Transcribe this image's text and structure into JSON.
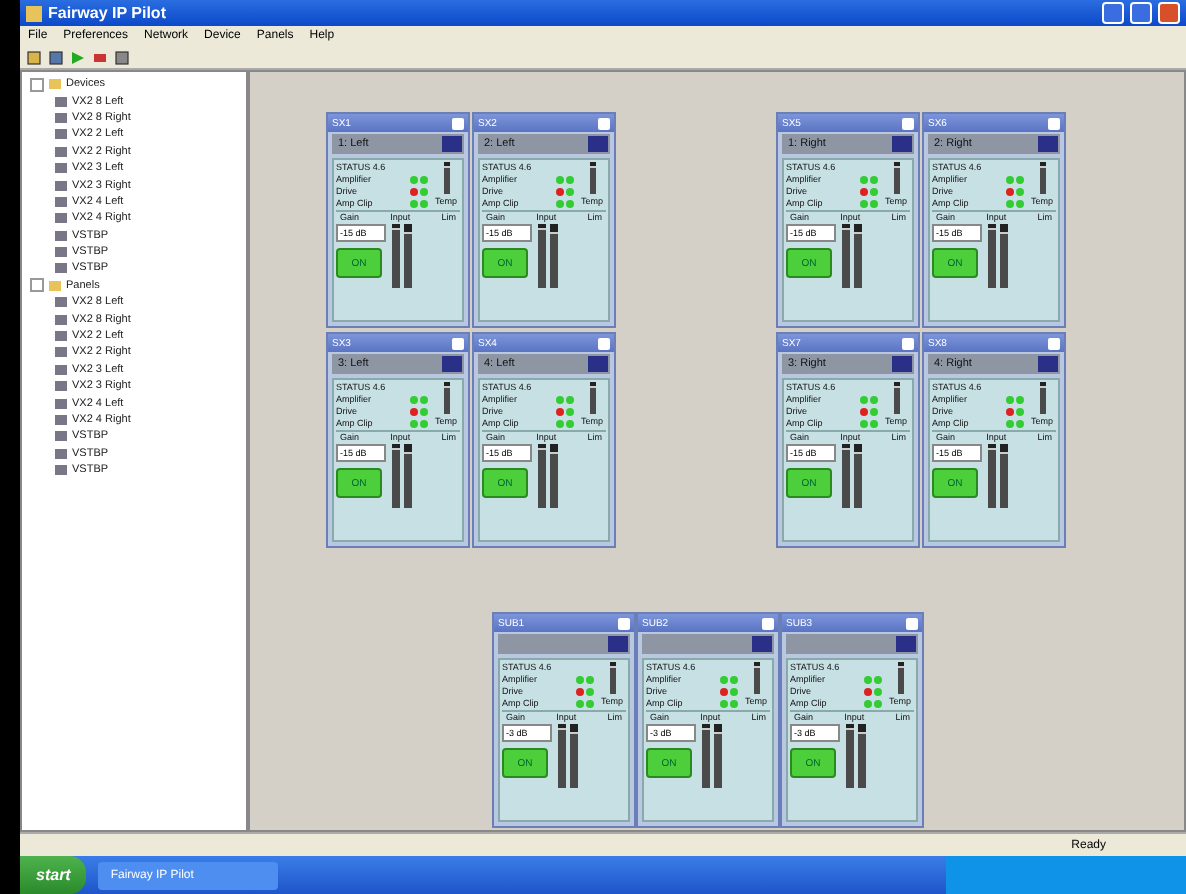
{
  "window": {
    "title": "Fairway IP Pilot"
  },
  "menu": [
    "File",
    "Preferences",
    "Network",
    "Device",
    "Panels",
    "Help"
  ],
  "tree": [
    {
      "label": "Devices",
      "expanded": true,
      "children": [
        {
          "label": "VX2 8 Left"
        },
        {
          "label": "VX2 8 Right"
        },
        {
          "label": "VX2 2 Left"
        },
        {
          "label": "VX2 2 Right"
        },
        {
          "label": "VX2 3 Left"
        },
        {
          "label": "VX2 3 Right"
        },
        {
          "label": "VX2 4 Left"
        },
        {
          "label": "VX2 4 Right"
        },
        {
          "label": "VSTBP"
        },
        {
          "label": "VSTBP"
        },
        {
          "label": "VSTBP"
        }
      ]
    },
    {
      "label": "Panels",
      "expanded": true,
      "children": [
        {
          "label": "VX2 8 Left"
        },
        {
          "label": "VX2 8 Right"
        },
        {
          "label": "VX2 2 Left"
        },
        {
          "label": "VX2 2 Right"
        },
        {
          "label": "VX2 3 Left"
        },
        {
          "label": "VX2 3 Right"
        },
        {
          "label": "VX2 4 Left"
        },
        {
          "label": "VX2 4 Right"
        },
        {
          "label": "VSTBP"
        },
        {
          "label": "VSTBP"
        },
        {
          "label": "VSTBP"
        }
      ]
    }
  ],
  "panels": [
    {
      "title": "SX1",
      "channel": "1: Left",
      "status": "STATUS 4.6",
      "leds": [
        {
          "label": "Amplifier",
          "color": "#33cc33"
        },
        {
          "label": "Drive",
          "color": "#dd2222"
        },
        {
          "label": "Amp Clip",
          "color": "#33cc33"
        }
      ],
      "temp": "Temp",
      "heads": [
        "Gain",
        "Input",
        "Lim"
      ],
      "value": "-15 dB",
      "on": "ON",
      "meters": [
        {
          "level": 0.8
        },
        {
          "level": 0.9
        },
        {
          "level": 0.85
        }
      ]
    },
    {
      "title": "SX2",
      "channel": "2: Left",
      "status": "STATUS 4.6",
      "leds": [
        {
          "label": "Amplifier",
          "color": "#33cc33"
        },
        {
          "label": "Drive",
          "color": "#dd2222"
        },
        {
          "label": "Amp Clip",
          "color": "#33cc33"
        }
      ],
      "temp": "Temp",
      "heads": [
        "Gain",
        "Input",
        "Lim"
      ],
      "value": "-15 dB",
      "on": "ON",
      "meters": [
        {
          "level": 0.8
        },
        {
          "level": 0.9
        },
        {
          "level": 0.85
        }
      ]
    },
    {
      "title": "SX3",
      "channel": "3: Left",
      "status": "STATUS 4.6",
      "leds": [
        {
          "label": "Amplifier",
          "color": "#33cc33"
        },
        {
          "label": "Drive",
          "color": "#dd2222"
        },
        {
          "label": "Amp Clip",
          "color": "#33cc33"
        }
      ],
      "temp": "Temp",
      "heads": [
        "Gain",
        "Input",
        "Lim"
      ],
      "value": "-15 dB",
      "on": "ON",
      "meters": [
        {
          "level": 0.8
        },
        {
          "level": 0.9
        },
        {
          "level": 0.85
        }
      ]
    },
    {
      "title": "SX4",
      "channel": "4: Left",
      "status": "STATUS 4.6",
      "leds": [
        {
          "label": "Amplifier",
          "color": "#33cc33"
        },
        {
          "label": "Drive",
          "color": "#dd2222"
        },
        {
          "label": "Amp Clip",
          "color": "#33cc33"
        }
      ],
      "temp": "Temp",
      "heads": [
        "Gain",
        "Input",
        "Lim"
      ],
      "value": "-15 dB",
      "on": "ON",
      "meters": [
        {
          "level": 0.8
        },
        {
          "level": 0.9
        },
        {
          "level": 0.85
        }
      ]
    },
    {
      "title": "SX5",
      "channel": "1: Right",
      "status": "STATUS 4.6",
      "leds": [
        {
          "label": "Amplifier",
          "color": "#33cc33"
        },
        {
          "label": "Drive",
          "color": "#dd2222"
        },
        {
          "label": "Amp Clip",
          "color": "#33cc33"
        }
      ],
      "temp": "Temp",
      "heads": [
        "Gain",
        "Input",
        "Lim"
      ],
      "value": "-15 dB",
      "on": "ON",
      "meters": [
        {
          "level": 0.8
        },
        {
          "level": 0.9
        },
        {
          "level": 0.85
        }
      ]
    },
    {
      "title": "SX6",
      "channel": "2: Right",
      "status": "STATUS 4.6",
      "leds": [
        {
          "label": "Amplifier",
          "color": "#33cc33"
        },
        {
          "label": "Drive",
          "color": "#dd2222"
        },
        {
          "label": "Amp Clip",
          "color": "#33cc33"
        }
      ],
      "temp": "Temp",
      "heads": [
        "Gain",
        "Input",
        "Lim"
      ],
      "value": "-15 dB",
      "on": "ON",
      "meters": [
        {
          "level": 0.8
        },
        {
          "level": 0.9
        },
        {
          "level": 0.85
        }
      ]
    },
    {
      "title": "SX7",
      "channel": "3: Right",
      "status": "STATUS 4.6",
      "leds": [
        {
          "label": "Amplifier",
          "color": "#33cc33"
        },
        {
          "label": "Drive",
          "color": "#dd2222"
        },
        {
          "label": "Amp Clip",
          "color": "#33cc33"
        }
      ],
      "temp": "Temp",
      "heads": [
        "Gain",
        "Input",
        "Lim"
      ],
      "value": "-15 dB",
      "on": "ON",
      "meters": [
        {
          "level": 0.8
        },
        {
          "level": 0.9
        },
        {
          "level": 0.85
        }
      ]
    },
    {
      "title": "SX8",
      "channel": "4: Right",
      "status": "STATUS 4.6",
      "leds": [
        {
          "label": "Amplifier",
          "color": "#33cc33"
        },
        {
          "label": "Drive",
          "color": "#dd2222"
        },
        {
          "label": "Amp Clip",
          "color": "#33cc33"
        }
      ],
      "temp": "Temp",
      "heads": [
        "Gain",
        "Input",
        "Lim"
      ],
      "value": "-15 dB",
      "on": "ON",
      "meters": [
        {
          "level": 0.8
        },
        {
          "level": 0.9
        },
        {
          "level": 0.85
        }
      ]
    },
    {
      "title": "SUB1",
      "status": "STATUS 4.6",
      "leds": [
        {
          "label": "Amplifier",
          "color": "#33cc33"
        },
        {
          "label": "Drive",
          "color": "#dd2222"
        },
        {
          "label": "Amp Clip",
          "color": "#33cc33"
        }
      ],
      "temp": "Temp",
      "heads": [
        "Gain",
        "Input",
        "Lim"
      ],
      "value": "-3 dB",
      "on": "ON",
      "meters": [
        {
          "level": 0.8
        },
        {
          "level": 0.9
        },
        {
          "level": 0.85
        }
      ]
    },
    {
      "title": "SUB2",
      "status": "STATUS 4.6",
      "leds": [
        {
          "label": "Amplifier",
          "color": "#33cc33"
        },
        {
          "label": "Drive",
          "color": "#dd2222"
        },
        {
          "label": "Amp Clip",
          "color": "#33cc33"
        }
      ],
      "temp": "Temp",
      "heads": [
        "Gain",
        "Input",
        "Lim"
      ],
      "value": "-3 dB",
      "on": "ON",
      "meters": [
        {
          "level": 0.8
        },
        {
          "level": 0.9
        },
        {
          "level": 0.85
        }
      ]
    },
    {
      "title": "SUB3",
      "status": "STATUS 4.6",
      "leds": [
        {
          "label": "Amplifier",
          "color": "#33cc33"
        },
        {
          "label": "Drive",
          "color": "#dd2222"
        },
        {
          "label": "Amp Clip",
          "color": "#33cc33"
        }
      ],
      "temp": "Temp",
      "heads": [
        "Gain",
        "Input",
        "Lim"
      ],
      "value": "-3 dB",
      "on": "ON",
      "meters": [
        {
          "level": 0.8
        },
        {
          "level": 0.9
        },
        {
          "level": 0.85
        }
      ]
    }
  ],
  "status_bar": "Ready",
  "taskbar": {
    "start": "start",
    "task": "Fairway IP Pilot"
  }
}
